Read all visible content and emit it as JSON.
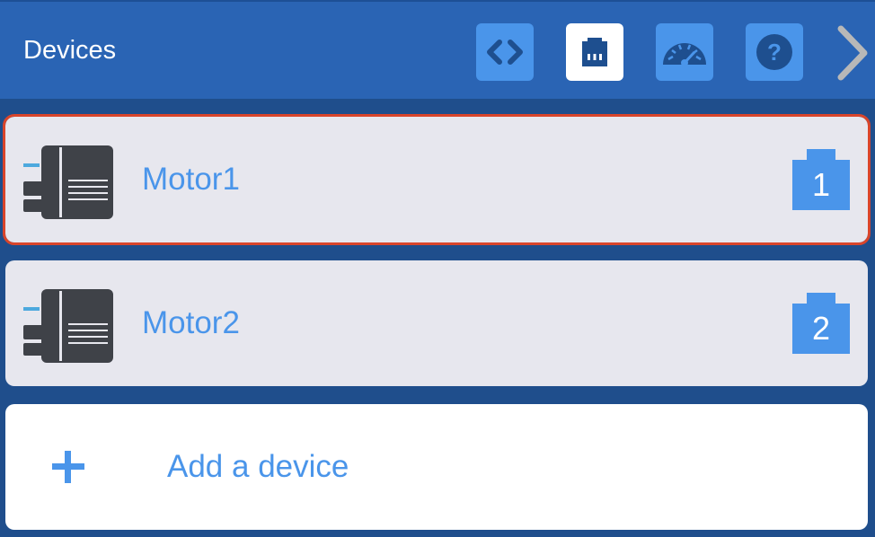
{
  "header": {
    "title": "Devices",
    "buttons": [
      {
        "icon": "code-icon",
        "active": false
      },
      {
        "icon": "ethernet-port-icon",
        "active": true
      },
      {
        "icon": "dashboard-gauge-icon",
        "active": false
      },
      {
        "icon": "help-icon",
        "active": false
      }
    ],
    "next_icon": "chevron-right-icon"
  },
  "devices": [
    {
      "name": "Motor1",
      "port": "1",
      "selected": true,
      "icon": "motor-icon"
    },
    {
      "name": "Motor2",
      "port": "2",
      "selected": false,
      "icon": "motor-icon"
    }
  ],
  "add_device": {
    "label": "Add a device",
    "icon": "plus-icon"
  },
  "colors": {
    "header_bg": "#2a64b4",
    "page_bg": "#1f4e8c",
    "accent": "#4a95ea",
    "selection_outline": "#d9452b",
    "row_bg": "#e7e7ee"
  }
}
